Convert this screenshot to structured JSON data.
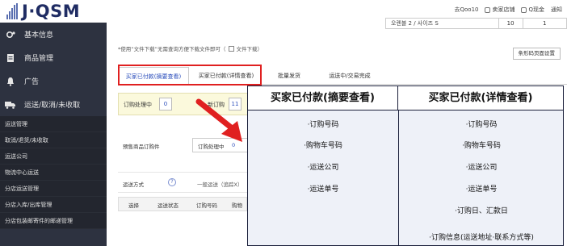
{
  "header": {
    "logo_text": "J·QSM",
    "links": [
      "去Qoo10",
      "卖家店铺",
      "Q现金",
      "通知"
    ]
  },
  "sidebar": {
    "items": [
      {
        "label": "基本信息",
        "icon": "gear-icon"
      },
      {
        "label": "商品管理",
        "icon": "document-icon"
      },
      {
        "label": "广告",
        "icon": "bell-icon"
      },
      {
        "label": "运送/取消/未收取",
        "icon": "truck-icon"
      }
    ],
    "subitems": [
      "运送管理",
      "取消/退货/未收取",
      "运送公司",
      "物流中心运送",
      "分店运送管理",
      "分店入库/出库管理",
      "分店包装邮寄件的邮递管理"
    ]
  },
  "main": {
    "top_row": {
      "text": "오렌블 2 / 사이즈 S",
      "qty": "10",
      "count": "1"
    },
    "notice": "*使用“文件下载”无需查询方便下载文件即可（",
    "notice_check_label": "文件下载）",
    "barcode_button": "条形码页面设置",
    "tabs": [
      "买家已付款(摘要查看)",
      "买家已付款(详情查看)",
      "批量发货",
      "运送中/交易完成"
    ],
    "status": {
      "label1": "订购处理中",
      "value1": "0",
      "label2": "新订购",
      "value2": "11"
    },
    "presale_label": "预售商品订购件",
    "order_count": {
      "label": "订购处理中",
      "value": "0"
    },
    "shipping_label": "运送方式",
    "shipping_value": "一般运送（追踪X）",
    "grid_headers": [
      "选择",
      "运送状态",
      "订购号码",
      "购物"
    ]
  },
  "compare": {
    "left_title": "买家已付款(摘要查看)",
    "right_title": "买家已付款(详情查看)",
    "left_items": [
      "·订购号码",
      "·购物车号码",
      "·运送公司",
      "·运送单号"
    ],
    "right_items": [
      "·订购号码",
      "·购物车号码",
      "·运送公司",
      "·运送单号",
      "·订购日、汇款日",
      "·订购信息(运送地址·联系方式等)"
    ]
  },
  "colors": {
    "sidebar": "#2d3240",
    "accent": "#2a4dbb",
    "highlight": "#e02020",
    "overlay_bg": "#eef1f8"
  }
}
